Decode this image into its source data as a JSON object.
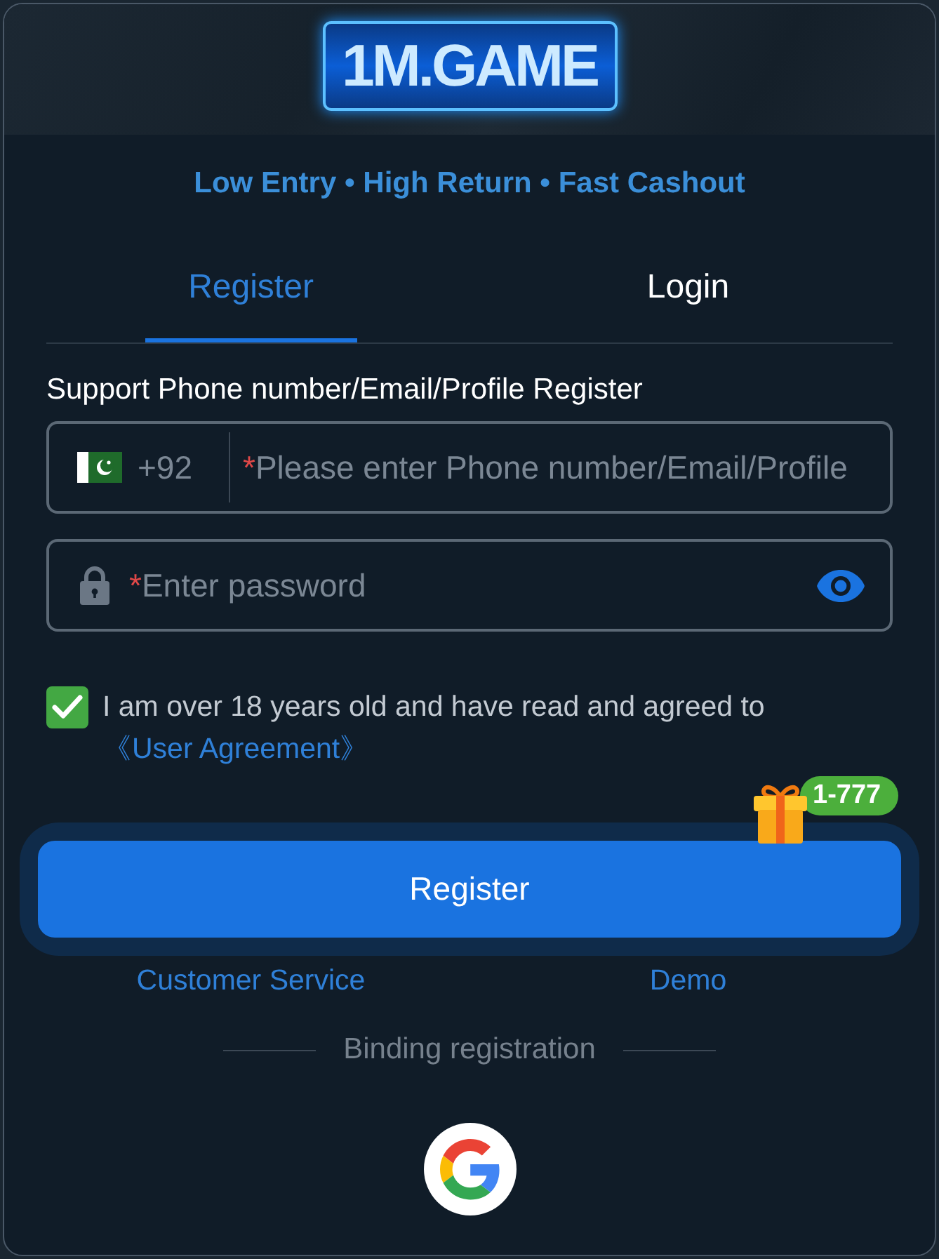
{
  "logo": {
    "text": "1M.GAME"
  },
  "tagline": "Low Entry • High Return • Fast Cashout",
  "tabs": [
    {
      "label": "Register",
      "selected": true
    },
    {
      "label": "Login",
      "selected": false
    }
  ],
  "form": {
    "label": "Support Phone number/Email/Profile Register",
    "phone_field": {
      "country_code": "+92",
      "required_mark": "*",
      "placeholder": "Please enter Phone number/Email/Profile"
    },
    "password_field": {
      "required_mark": "*",
      "placeholder": "Enter password"
    }
  },
  "agreement": {
    "checked": true,
    "text": "I am over 18 years old and have read and agreed to",
    "link": "《User Agreement》"
  },
  "register_button": {
    "label": "Register",
    "badge": "1-777"
  },
  "links": [
    {
      "label": "Customer Service"
    },
    {
      "label": "Demo"
    }
  ],
  "binding": {
    "label": "Binding registration"
  }
}
